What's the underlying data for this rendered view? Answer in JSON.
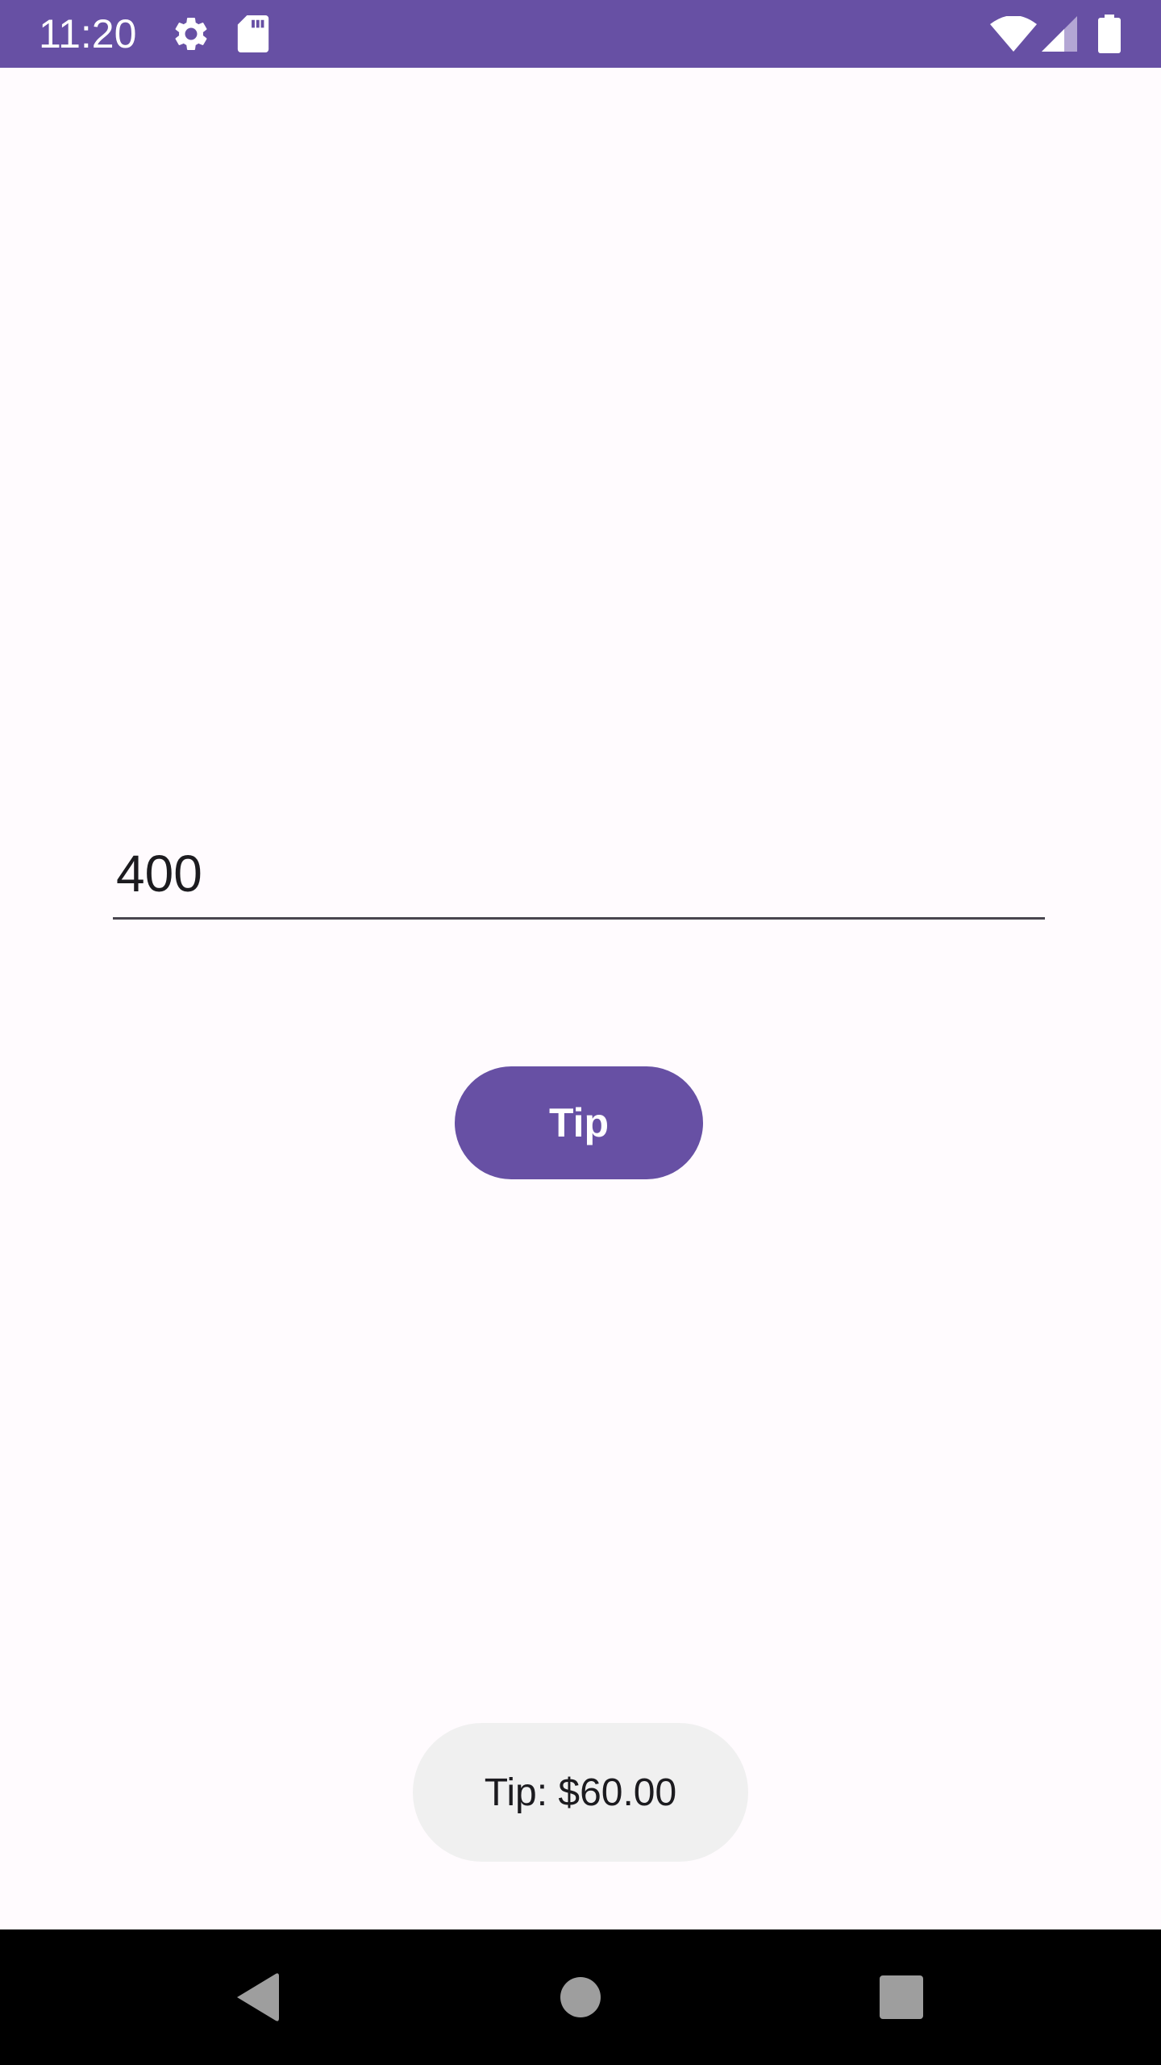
{
  "status_bar": {
    "time": "11:20",
    "icons": [
      "gear-icon",
      "sd-card-icon",
      "wifi-icon",
      "cell-signal-icon",
      "battery-icon"
    ],
    "background": "#6750a4"
  },
  "main": {
    "amount_field": {
      "value": "400",
      "placeholder": ""
    },
    "tip_button": {
      "label": "Tip",
      "color": "#6750a4"
    }
  },
  "toast": {
    "message": "Tip: $60.00"
  },
  "nav_bar": {
    "buttons": [
      "back-icon",
      "home-icon",
      "recents-icon"
    ]
  }
}
